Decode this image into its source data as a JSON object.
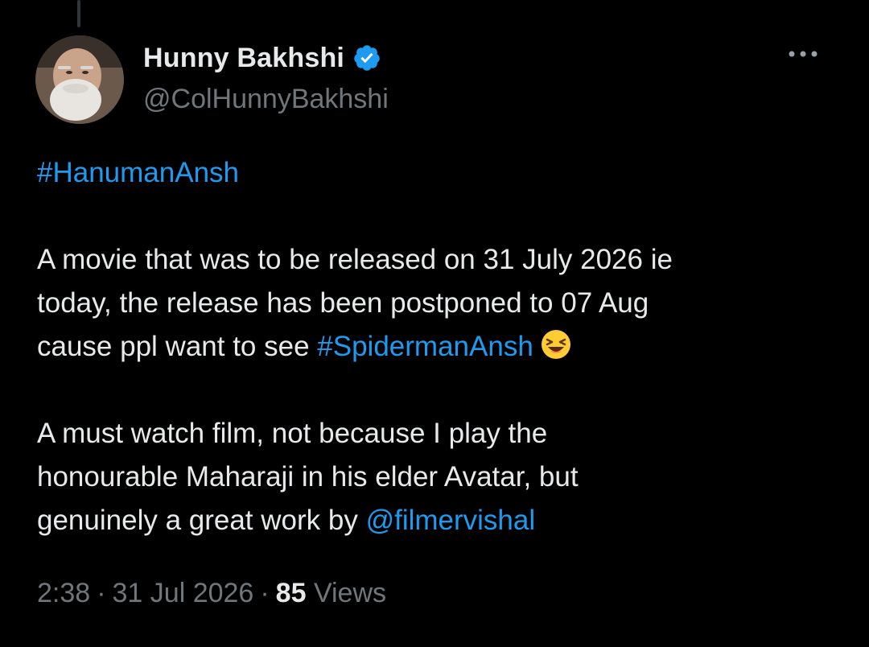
{
  "author": {
    "display_name": "Hunny Bakhshi",
    "handle": "@ColHunnyBakhshi",
    "verified": true,
    "verified_color": "#1d9bf0"
  },
  "tweet": {
    "hashtag_line": "#HanumanAnsh",
    "para1": {
      "line1": "A movie that was to be released on 31 July 2026 ie",
      "line2": "today, the release has been postponed to 07 Aug",
      "line3_prefix": "cause ppl want to see ",
      "line3_hashtag": "#SpidermanAnsh",
      "emoji": "laughing-emoji"
    },
    "para2": {
      "line1": "A must watch film, not because I play the",
      "line2": "honourable Maharaji in his elder Avatar, but",
      "line3_prefix": "genuinely a great work by ",
      "line3_mention": "@filmervishal"
    }
  },
  "meta": {
    "time": "2:38",
    "date": "31 Jul 2026",
    "views_count": "85",
    "views_label": "Views",
    "separator": "·"
  },
  "colors": {
    "background": "#000000",
    "text": "#e7e9ea",
    "secondary_text": "#71767b",
    "link": "#1d9bf0"
  },
  "icons": [
    "verified-badge-icon",
    "more-options-icon",
    "laughing-emoji"
  ]
}
